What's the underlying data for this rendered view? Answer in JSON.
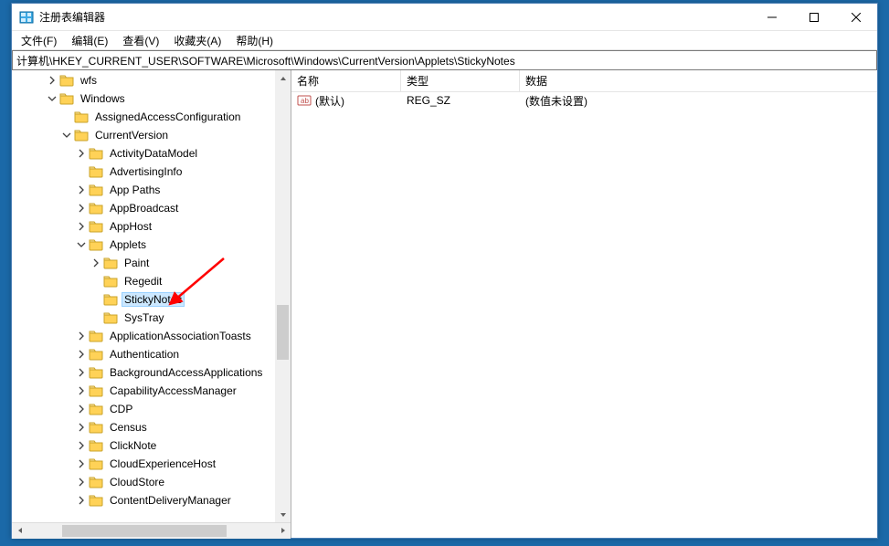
{
  "window": {
    "title": "注册表编辑器"
  },
  "menus": {
    "file": "文件(F)",
    "edit": "编辑(E)",
    "view": "查看(V)",
    "favorites": "收藏夹(A)",
    "help": "帮助(H)"
  },
  "address": "计算机\\HKEY_CURRENT_USER\\SOFTWARE\\Microsoft\\Windows\\CurrentVersion\\Applets\\StickyNotes",
  "tree": [
    {
      "indent": 2,
      "expander": "closed",
      "label": "wfs"
    },
    {
      "indent": 2,
      "expander": "open",
      "label": "Windows"
    },
    {
      "indent": 3,
      "expander": "none",
      "label": "AssignedAccessConfiguration"
    },
    {
      "indent": 3,
      "expander": "open",
      "label": "CurrentVersion"
    },
    {
      "indent": 4,
      "expander": "closed",
      "label": "ActivityDataModel"
    },
    {
      "indent": 4,
      "expander": "none",
      "label": "AdvertisingInfo"
    },
    {
      "indent": 4,
      "expander": "closed",
      "label": "App Paths"
    },
    {
      "indent": 4,
      "expander": "closed",
      "label": "AppBroadcast"
    },
    {
      "indent": 4,
      "expander": "closed",
      "label": "AppHost"
    },
    {
      "indent": 4,
      "expander": "open",
      "label": "Applets"
    },
    {
      "indent": 5,
      "expander": "closed",
      "label": "Paint"
    },
    {
      "indent": 5,
      "expander": "none",
      "label": "Regedit"
    },
    {
      "indent": 5,
      "expander": "none",
      "label": "StickyNotes",
      "selected": true
    },
    {
      "indent": 5,
      "expander": "none",
      "label": "SysTray"
    },
    {
      "indent": 4,
      "expander": "closed",
      "label": "ApplicationAssociationToasts"
    },
    {
      "indent": 4,
      "expander": "closed",
      "label": "Authentication"
    },
    {
      "indent": 4,
      "expander": "closed",
      "label": "BackgroundAccessApplications"
    },
    {
      "indent": 4,
      "expander": "closed",
      "label": "CapabilityAccessManager"
    },
    {
      "indent": 4,
      "expander": "closed",
      "label": "CDP"
    },
    {
      "indent": 4,
      "expander": "closed",
      "label": "Census"
    },
    {
      "indent": 4,
      "expander": "closed",
      "label": "ClickNote"
    },
    {
      "indent": 4,
      "expander": "closed",
      "label": "CloudExperienceHost"
    },
    {
      "indent": 4,
      "expander": "closed",
      "label": "CloudStore"
    },
    {
      "indent": 4,
      "expander": "closed",
      "label": "ContentDeliveryManager"
    }
  ],
  "columns": {
    "name": "名称",
    "type": "类型",
    "data": "数据"
  },
  "values": [
    {
      "name": "(默认)",
      "type": "REG_SZ",
      "data": "(数值未设置)",
      "icon": "string"
    }
  ],
  "colwidths": {
    "name": 120,
    "type": 130,
    "data": 300
  }
}
